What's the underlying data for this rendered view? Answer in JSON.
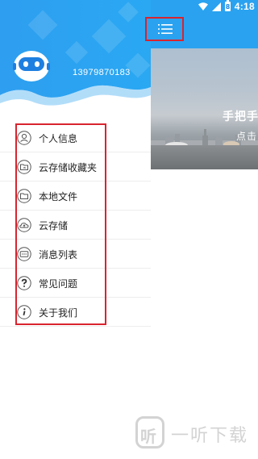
{
  "status_bar": {
    "time": "4:18",
    "battery_level": "8",
    "icons": [
      "wifi-icon",
      "signal-icon",
      "battery-icon"
    ]
  },
  "colors": {
    "header_blue": "#2aa2f0",
    "annotation_red": "#d9242f"
  },
  "drawer": {
    "user_phone": "13979870183",
    "avatar_icon": "robot-avatar-icon",
    "menu_items": [
      {
        "label": "个人信息",
        "icon": "user-icon"
      },
      {
        "label": "云存储收藏夹",
        "icon": "cloud-folder-icon"
      },
      {
        "label": "本地文件",
        "icon": "folder-icon"
      },
      {
        "label": "云存储",
        "icon": "cloud-upload-icon"
      },
      {
        "label": "消息列表",
        "icon": "message-icon"
      },
      {
        "label": "常见问题",
        "icon": "question-icon"
      },
      {
        "label": "关于我们",
        "icon": "info-icon"
      }
    ]
  },
  "main": {
    "menu_button_icon": "hamburger-menu-icon",
    "banner_line_1": "手把手",
    "banner_line_2": "点击"
  },
  "watermark": {
    "badge": "听",
    "text": "一听下载"
  }
}
